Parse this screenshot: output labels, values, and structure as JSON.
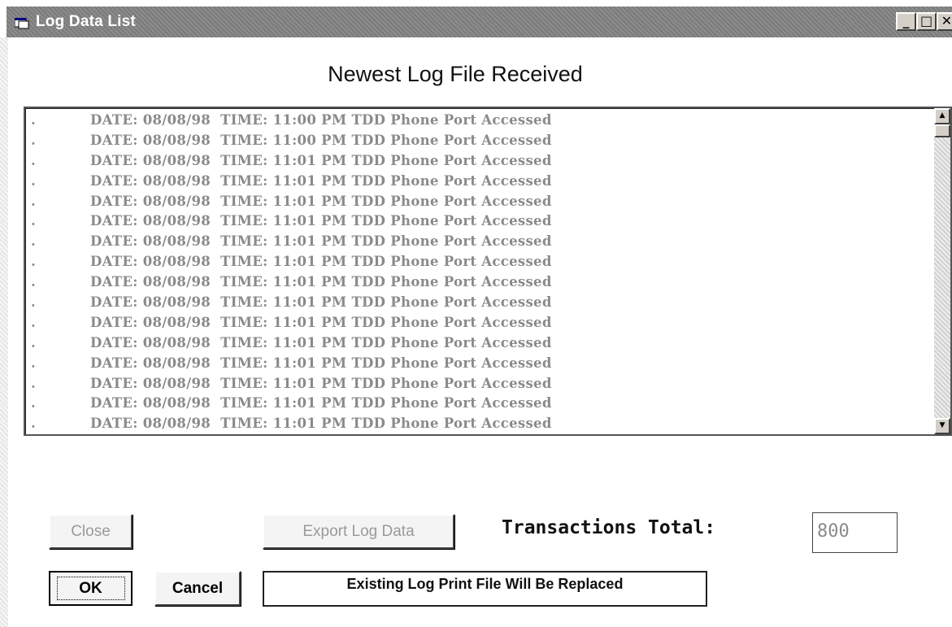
{
  "window": {
    "title": "Log Data List",
    "controls": {
      "minimize": "_",
      "maximize": "□",
      "close": "✕"
    }
  },
  "heading": "Newest Log File Received",
  "log": {
    "rows": [
      {
        "marker": ".",
        "text": "DATE: 08/08/98  TIME: 11:00 PM TDD Phone Port Accessed"
      },
      {
        "marker": ".",
        "text": "DATE: 08/08/98  TIME: 11:00 PM TDD Phone Port Accessed"
      },
      {
        "marker": ".",
        "text": "DATE: 08/08/98  TIME: 11:01 PM TDD Phone Port Accessed"
      },
      {
        "marker": ".",
        "text": "DATE: 08/08/98  TIME: 11:01 PM TDD Phone Port Accessed"
      },
      {
        "marker": ".",
        "text": "DATE: 08/08/98  TIME: 11:01 PM TDD Phone Port Accessed"
      },
      {
        "marker": ".",
        "text": "DATE: 08/08/98  TIME: 11:01 PM TDD Phone Port Accessed"
      },
      {
        "marker": ".",
        "text": "DATE: 08/08/98  TIME: 11:01 PM TDD Phone Port Accessed"
      },
      {
        "marker": ".",
        "text": "DATE: 08/08/98  TIME: 11:01 PM TDD Phone Port Accessed"
      },
      {
        "marker": ".",
        "text": "DATE: 08/08/98  TIME: 11:01 PM TDD Phone Port Accessed"
      },
      {
        "marker": ".",
        "text": "DATE: 08/08/98  TIME: 11:01 PM TDD Phone Port Accessed"
      },
      {
        "marker": ".",
        "text": "DATE: 08/08/98  TIME: 11:01 PM TDD Phone Port Accessed"
      },
      {
        "marker": ".",
        "text": "DATE: 08/08/98  TIME: 11:01 PM TDD Phone Port Accessed"
      },
      {
        "marker": ".",
        "text": "DATE: 08/08/98  TIME: 11:01 PM TDD Phone Port Accessed"
      },
      {
        "marker": ".",
        "text": "DATE: 08/08/98  TIME: 11:01 PM TDD Phone Port Accessed"
      },
      {
        "marker": ".",
        "text": "DATE: 08/08/98  TIME: 11:01 PM TDD Phone Port Accessed"
      },
      {
        "marker": ".",
        "text": "DATE: 08/08/98  TIME: 11:01 PM TDD Phone Port Accessed"
      }
    ],
    "scroll_up": "▲",
    "scroll_down": "▼"
  },
  "buttons": {
    "close": "Close",
    "export": "Export Log Data",
    "ok": "OK",
    "cancel": "Cancel"
  },
  "transactions": {
    "label": "Transactions Total:",
    "value": "800"
  },
  "message": "Existing Log Print File Will Be Replaced",
  "colors": {
    "title_bar": "#858585",
    "log_text": "#8a8a8a",
    "disabled_text": "#9a9a9a"
  }
}
